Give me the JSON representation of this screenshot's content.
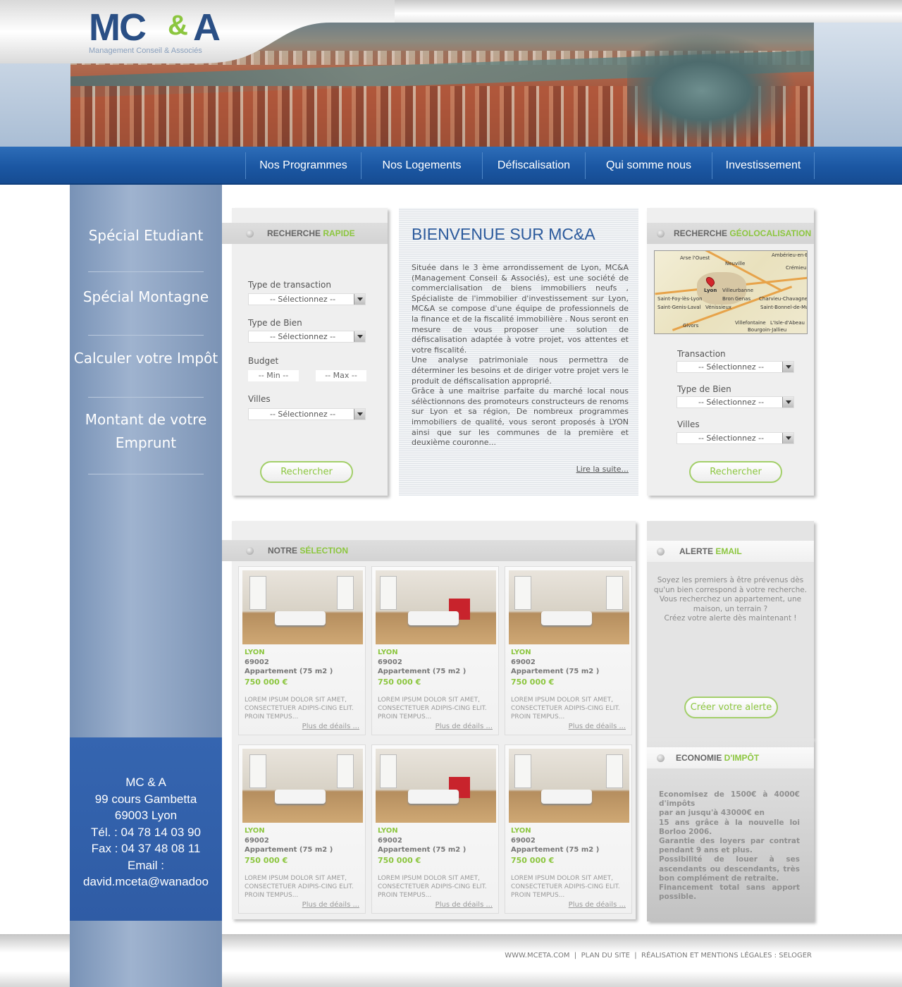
{
  "logo": {
    "mc": "MC",
    "amp": "&",
    "a": "A",
    "tagline": "Management Conseil & Associés"
  },
  "nav": [
    "Nos Programmes",
    "Nos Logements",
    "Défiscalisation",
    "Qui somme nous",
    "Investissement"
  ],
  "sidebar": {
    "items": [
      "Spécial Etudiant",
      "Spécial Montagne",
      "Calculer votre Impôt",
      "Montant de votre",
      "Emprunt"
    ],
    "contact": [
      "MC & A",
      "99 cours Gambetta",
      "69003 Lyon",
      "Tél. : 04 78 14 03 90",
      "Fax : 04 37 48 08 11",
      "Email :",
      "david.mceta@wanadoo"
    ]
  },
  "search_rapide": {
    "title_1": "RECHERCHE ",
    "title_2": "RAPIDE",
    "labels": [
      "Type de transaction",
      "Type de Bien",
      "Budget",
      "Villes"
    ],
    "select_placeholder": "-- Sélectionnez --",
    "min": "-- Min --",
    "max": "-- Max --",
    "button": "Rechercher"
  },
  "welcome": {
    "title": "BIENVENUE SUR MC&A",
    "paragraphs": [
      "Située dans le 3 ème arrondissement de Lyon, MC&A (Management Conseil & Associés), est une société de commercialisation de biens immobiliers neufs , Spécialiste de l'immobilier d'investissement sur Lyon, MC&A se compose d'une équipe de professionnels de la finance et de la fiscalité immobilière . Nous seront en mesure de vous proposer une solution de défiscalisation adaptée à votre projet, vos attentes et votre fiscalité.",
      " Une analyse patrimoniale nous permettra de déterminer les besoins et de diriger votre projet vers le produit de défiscalisation approprié.",
      "Grâce à une maitrise parfaite du marché local nous sélèctionnons des promoteurs constructeurs de renoms sur Lyon et sa région, De nombreux programmes immobiliers de qualité, vous seront proposés à LYON ainsi que sur les communes de la première et deuxième couronne..."
    ],
    "more": "Lire la suite..."
  },
  "geoloc": {
    "title_1": "RECHERCHE ",
    "title_2": "GÉOLOCALISATION",
    "map_towns": [
      "Arse l'Ouest",
      "Ambérieu-en-Bugey",
      "Neuville",
      "Villeurbanne",
      "Lyon",
      "Saint-Foy-lès-Lyon",
      "Bron",
      "Genas",
      "Charvieu-Chavagneux",
      "Saint-Genis-Laval",
      "Vénissieux",
      "Saint-Bonnel-de-Mure",
      "Givors",
      "Villefontaine",
      "L'Isle-d'Abeau",
      "Bourgoin-Jallieu",
      "Crémieu"
    ],
    "labels": [
      "Transaction",
      "Type de Bien",
      "Villes"
    ],
    "select_placeholder": "-- Sélectionnez --",
    "button": "Rechercher"
  },
  "selection": {
    "title_1": "NOTRE ",
    "title_2": "SÉLECTION",
    "cards": [
      {
        "city": "LYON",
        "zip": "69002",
        "type": "Appartement (75 m2 )",
        "price": "750 000 €",
        "desc": "LOREM IPSUM DOLOR SIT AMET, CONSECTETUER ADIPIS-CING ELIT. PROIN TEMPUS...",
        "link": "Plus de déails ..."
      },
      {
        "city": "LYON",
        "zip": "69002",
        "type": "Appartement (75 m2 )",
        "price": "750 000 €",
        "desc": "LOREM IPSUM DOLOR SIT AMET, CONSECTETUER ADIPIS-CING ELIT. PROIN TEMPUS...",
        "link": "Plus de déails ..."
      },
      {
        "city": "LYON",
        "zip": "69002",
        "type": "Appartement (75 m2 )",
        "price": "750 000 €",
        "desc": "LOREM IPSUM DOLOR SIT AMET, CONSECTETUER ADIPIS-CING ELIT. PROIN TEMPUS...",
        "link": "Plus de déails ..."
      },
      {
        "city": "LYON",
        "zip": "69002",
        "type": "Appartement (75 m2 )",
        "price": "750 000 €",
        "desc": "LOREM IPSUM DOLOR SIT AMET, CONSECTETUER ADIPIS-CING ELIT. PROIN TEMPUS...",
        "link": "Plus de déails ..."
      },
      {
        "city": "LYON",
        "zip": "69002",
        "type": "Appartement (75 m2 )",
        "price": "750 000 €",
        "desc": "LOREM IPSUM DOLOR SIT AMET, CONSECTETUER ADIPIS-CING ELIT. PROIN TEMPUS...",
        "link": "Plus de déails ..."
      },
      {
        "city": "LYON",
        "zip": "69002",
        "type": "Appartement (75 m2 )",
        "price": "750 000 €",
        "desc": "LOREM IPSUM DOLOR SIT AMET, CONSECTETUER ADIPIS-CING ELIT. PROIN TEMPUS...",
        "link": "Plus de déails ..."
      }
    ]
  },
  "alerte": {
    "title_1": "ALERTE ",
    "title_2": "EMAIL",
    "text": [
      "Soyez les premiers à être prévenus dès",
      "qu'un bien correspond à votre recherche.",
      "Vous recherchez un appartement, une",
      "maison, un terrain ?",
      "Créez votre alerte dès maintenant !"
    ],
    "button": "Créer votre alerte"
  },
  "economie": {
    "title_1": "ECONOMIE ",
    "title_2": "D'IMPÔT",
    "lines": [
      "Economisez de 1500€ à 4000€ d'impôts",
      " par an jusqu'à 43000€ en",
      "15 ans grâce à la nouvelle loi Borloo 2006.",
      " Garantie des loyers par contrat pendant 9 ans et plus.",
      "Possibilité de louer à ses ascendants ou descendants, très bon complément de retraite.",
      " Financement total sans apport possible."
    ]
  },
  "footer": [
    "WWW.MCETA.COM",
    "PLAN DU SITE",
    "RÉALISATION ET MENTIONS LÉGALES : SELOGER"
  ],
  "colors": {
    "accent_green": "#8cc63f",
    "brand_blue": "#2a4f85",
    "nav_blue": "#1b57a3"
  }
}
